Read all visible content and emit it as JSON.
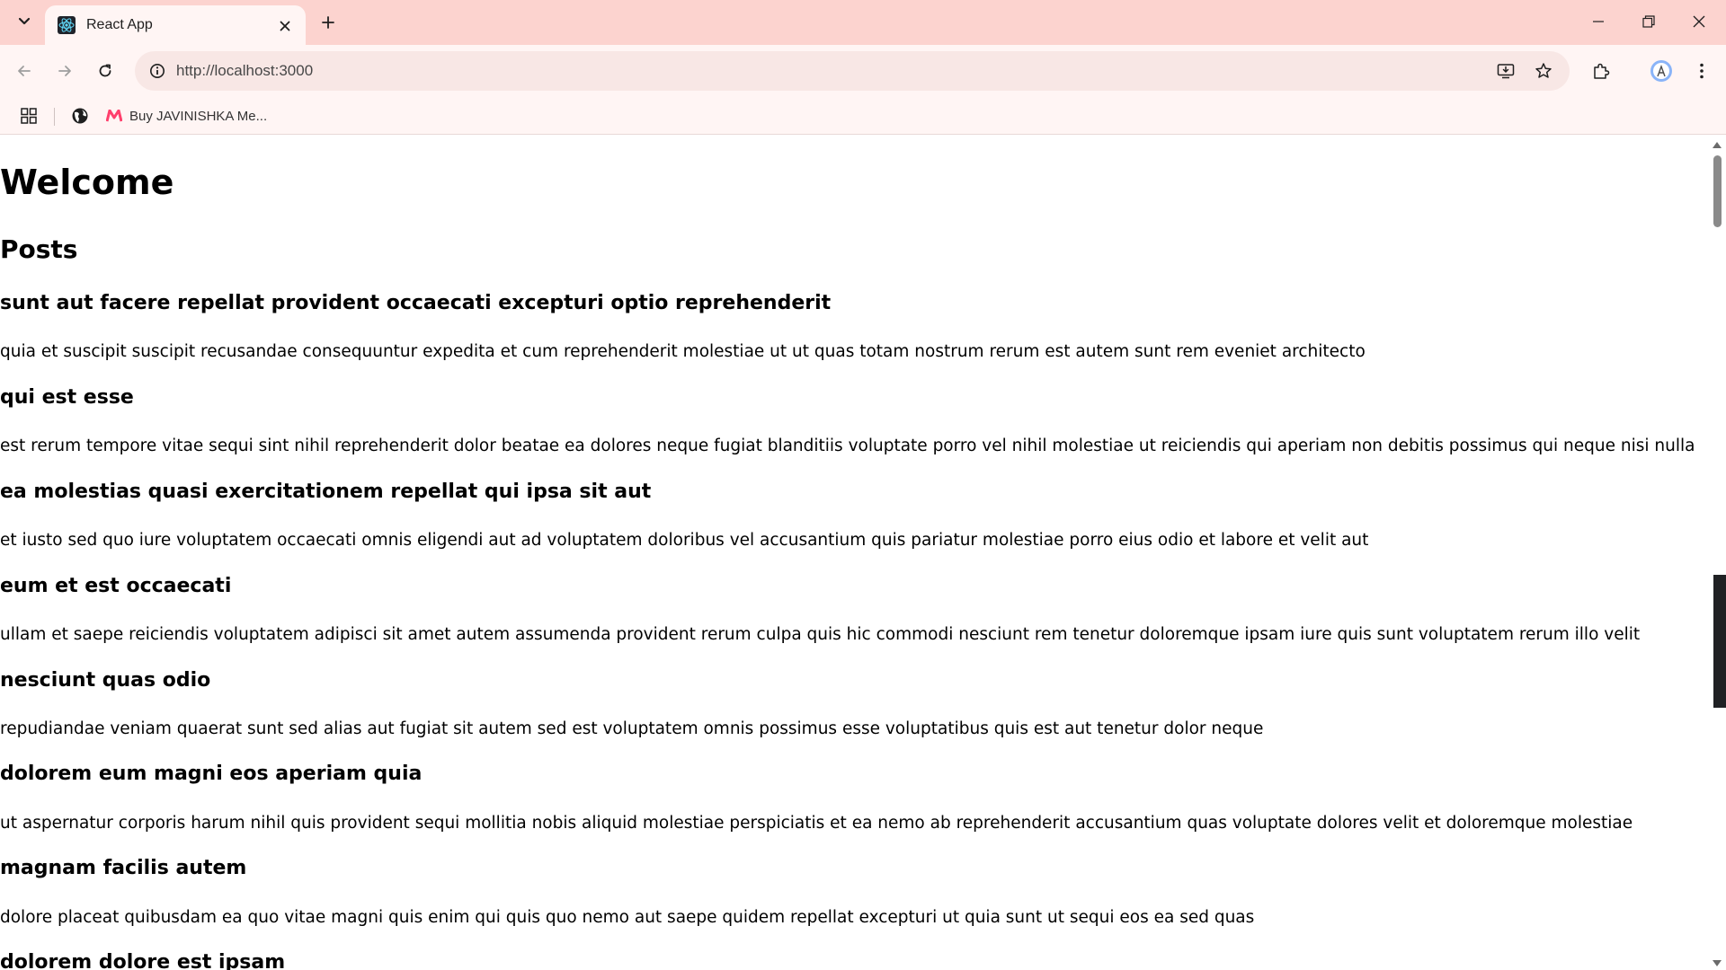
{
  "browser": {
    "tab": {
      "title": "React App",
      "icon": "react-logo-icon"
    },
    "url": "http://localhost:3000",
    "bookmarks": [
      {
        "label": "Buy JAVINISHKA Me...",
        "icon": "myntra-logo-icon"
      }
    ],
    "colors": {
      "frame": "#fcd3cf",
      "toolbar": "#fff5f4",
      "omnibox": "#f8e7e5",
      "avatar": "#8ab4f8"
    }
  },
  "page": {
    "heading": "Welcome",
    "section_heading": "Posts",
    "posts": [
      {
        "title": "sunt aut facere repellat provident occaecati excepturi optio reprehenderit",
        "body": "quia et suscipit suscipit recusandae consequuntur expedita et cum reprehenderit molestiae ut ut quas totam nostrum rerum est autem sunt rem eveniet architecto"
      },
      {
        "title": "qui est esse",
        "body": "est rerum tempore vitae sequi sint nihil reprehenderit dolor beatae ea dolores neque fugiat blanditiis voluptate porro vel nihil molestiae ut reiciendis qui aperiam non debitis possimus qui neque nisi nulla"
      },
      {
        "title": "ea molestias quasi exercitationem repellat qui ipsa sit aut",
        "body": "et iusto sed quo iure voluptatem occaecati omnis eligendi aut ad voluptatem doloribus vel accusantium quis pariatur molestiae porro eius odio et labore et velit aut"
      },
      {
        "title": "eum et est occaecati",
        "body": "ullam et saepe reiciendis voluptatem adipisci sit amet autem assumenda provident rerum culpa quis hic commodi nesciunt rem tenetur doloremque ipsam iure quis sunt voluptatem rerum illo velit"
      },
      {
        "title": "nesciunt quas odio",
        "body": "repudiandae veniam quaerat sunt sed alias aut fugiat sit autem sed est voluptatem omnis possimus esse voluptatibus quis est aut tenetur dolor neque"
      },
      {
        "title": "dolorem eum magni eos aperiam quia",
        "body": "ut aspernatur corporis harum nihil quis provident sequi mollitia nobis aliquid molestiae perspiciatis et ea nemo ab reprehenderit accusantium quas voluptate dolores velit et doloremque molestiae"
      },
      {
        "title": "magnam facilis autem",
        "body": "dolore placeat quibusdam ea quo vitae magni quis enim qui quis quo nemo aut saepe quidem repellat excepturi ut quia sunt ut sequi eos ea sed quas"
      },
      {
        "title": "dolorem dolore est ipsam",
        "body": ""
      }
    ]
  }
}
